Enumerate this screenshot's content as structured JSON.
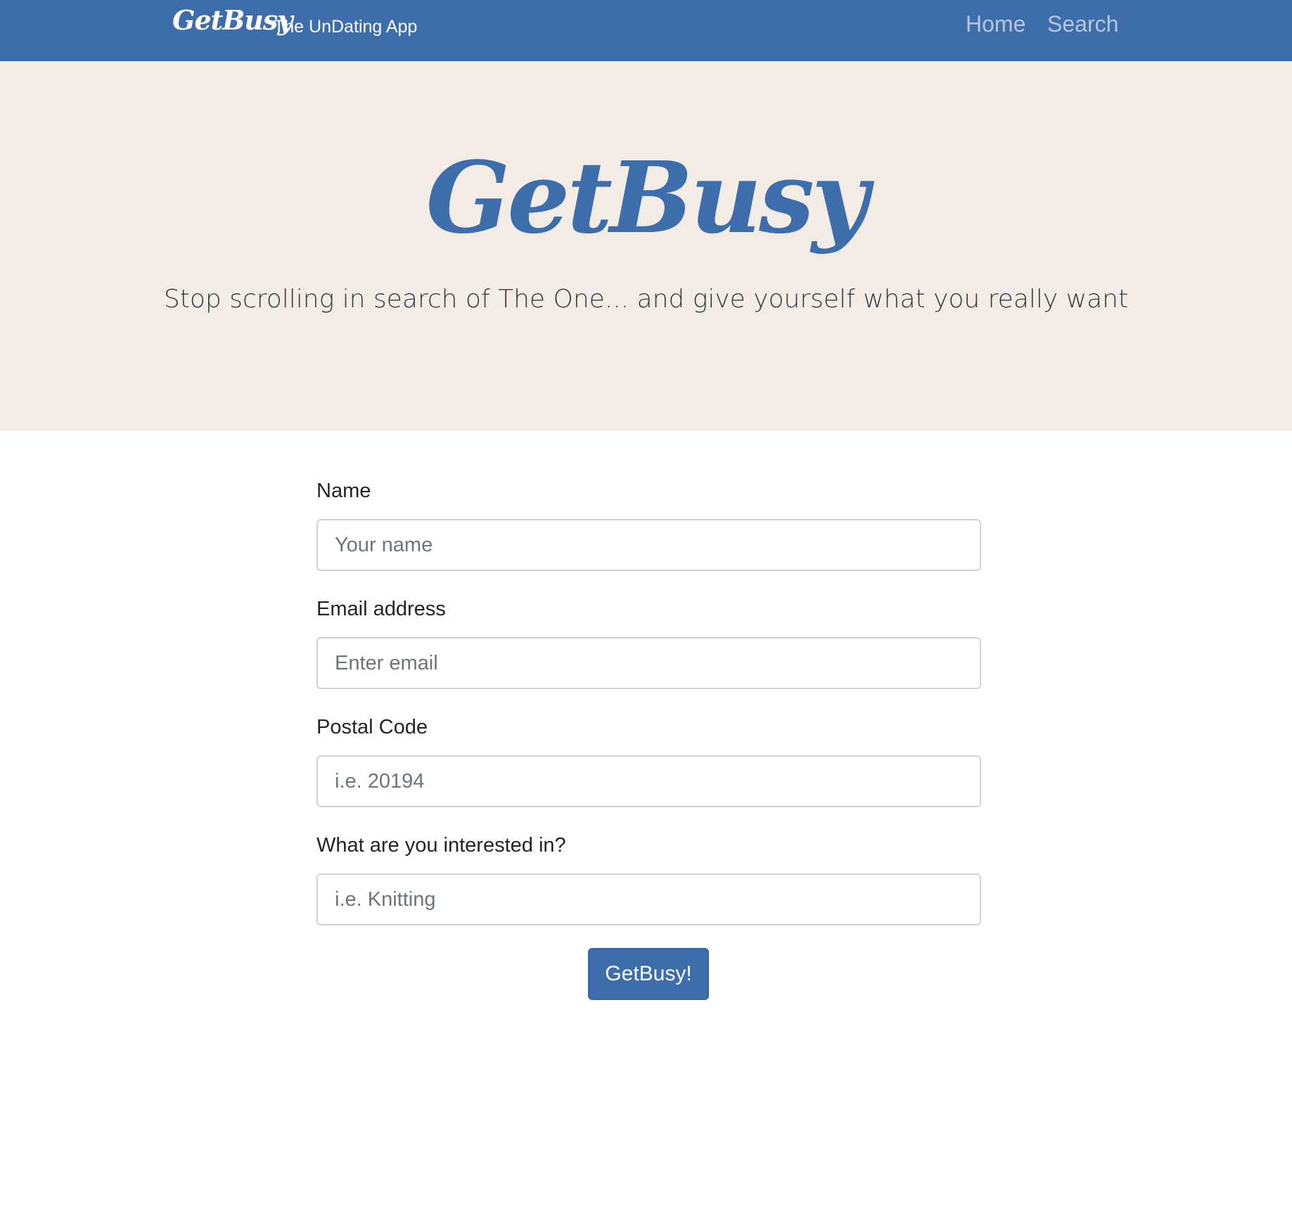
{
  "navbar": {
    "brand": "GetBusy",
    "tagline": "The UnDating App",
    "links": [
      "Home",
      "Search"
    ]
  },
  "hero": {
    "title": "GetBusy",
    "subtitle": "Stop scrolling in search of The One... and give yourself what you really want"
  },
  "form": {
    "fields": [
      {
        "label": "Name",
        "placeholder": "Your name"
      },
      {
        "label": "Email address",
        "placeholder": "Enter email"
      },
      {
        "label": "Postal Code",
        "placeholder": "i.e. 20194"
      },
      {
        "label": "What are you interested in?",
        "placeholder": "i.e. Knitting"
      }
    ],
    "submit_label": "GetBusy!"
  },
  "colors": {
    "brand_blue": "#3e6dac",
    "hero_background": "#f3ece4"
  }
}
